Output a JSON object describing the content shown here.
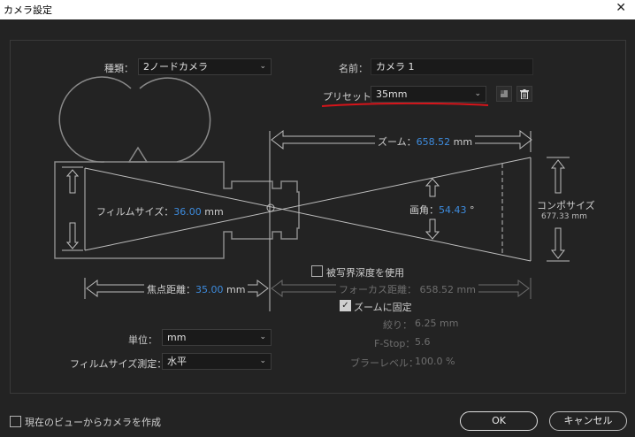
{
  "window": {
    "title": "カメラ設定",
    "close_glyph": "✕"
  },
  "type": {
    "label": "種類：",
    "value": "2ノードカメラ"
  },
  "name": {
    "label": "名前：",
    "value": "カメラ 1"
  },
  "preset": {
    "label": "プリセット：",
    "value": "35mm"
  },
  "zoom": {
    "label": "ズーム：",
    "value": "658.52",
    "unit": "mm"
  },
  "film_size": {
    "label": "フィルムサイズ：",
    "value": "36.00",
    "unit": "mm"
  },
  "angle": {
    "label": "画角：",
    "value": "54.43",
    "unit": "°"
  },
  "comp_size": {
    "label": "コンポサイズ",
    "value": "677.33 mm"
  },
  "focal_length": {
    "label": "焦点距離：",
    "value": "35.00",
    "unit": "mm"
  },
  "dof": {
    "label": "被写界深度を使用",
    "checked": false
  },
  "focus_distance": {
    "label": "フォーカス距離：",
    "value": "658.52 mm"
  },
  "lock_zoom": {
    "label": "ズームに固定",
    "checked": true
  },
  "aperture": {
    "label": "絞り：",
    "value": "6.25 mm"
  },
  "fstop": {
    "label": "F-Stop：",
    "value": "5.6"
  },
  "blur_level": {
    "label": "ブラーレベル：",
    "value": "100.0 %"
  },
  "units": {
    "label": "単位：",
    "value": "mm"
  },
  "measure_film": {
    "label": "フィルムサイズ測定：",
    "value": "水平"
  },
  "footer": {
    "create_from_view": "現在のビューからカメラを作成",
    "ok": "OK",
    "cancel": "キャンセル"
  },
  "icons": {
    "preset_save": "save-preset-icon",
    "preset_delete": "trash-icon"
  },
  "colors": {
    "value_blue": "#3d8bdd",
    "annotation_red": "#d7141a",
    "background": "#232323"
  }
}
